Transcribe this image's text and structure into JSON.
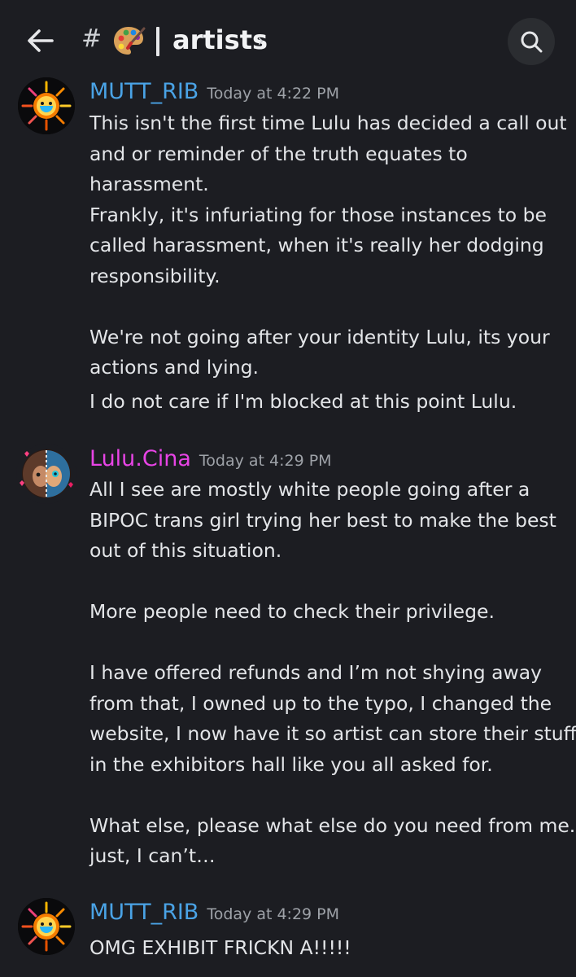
{
  "header": {
    "back_icon": "arrow-left-icon",
    "hash_symbol": "#",
    "channel_emoji": "artist-palette-icon",
    "channel_name": "artists",
    "chevron": "›",
    "search_icon": "search-icon"
  },
  "messages": [
    {
      "username": "MUTT_RIB",
      "timestamp": "Today at 4:22 PM",
      "name_color": "#4aa3e6",
      "lines": [
        "This isn't the first time Lulu has decided a call out",
        "and or reminder of the truth equates to",
        "harassment.",
        "Frankly, it's infuriating for those instances to be",
        "called harassment, when it's really her dodging",
        "responsibility.",
        "",
        "We're not going after your identity Lulu, its your",
        "actions and lying.",
        "I do not care if I'm blocked at this point Lulu."
      ]
    },
    {
      "username": "Lulu.Cina",
      "timestamp": "Today at 4:29 PM",
      "name_color": "#e844e6",
      "lines": [
        "All I see are mostly white people going after a",
        "BIPOC trans girl trying her best to make the best",
        "out of this situation.",
        "",
        "More people need to check their privilege.",
        "",
        "I have offered refunds and I’m not shying away",
        "from that, I owned up to the typo, I changed the",
        "website, I now have it so artist can store their stuff",
        "in the exhibitors hall like you all asked for.",
        "",
        "What else, please what else do you need from me. I",
        "just, I can’t…"
      ]
    },
    {
      "username": "MUTT_RIB",
      "timestamp": "Today at 4:29 PM",
      "name_color": "#4aa3e6",
      "lines": [
        "OMG EXHIBIT FRICKN A!!!!!"
      ]
    }
  ]
}
